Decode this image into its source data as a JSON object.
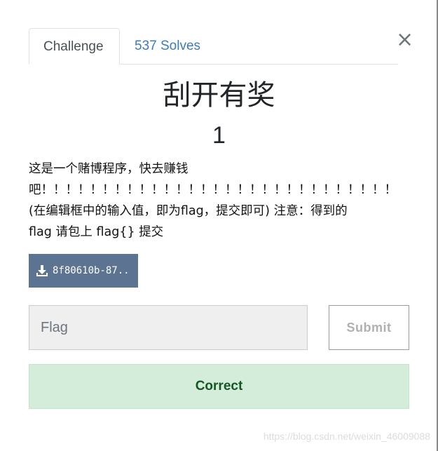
{
  "tabs": [
    {
      "label": "Challenge"
    },
    {
      "label": "537 Solves"
    }
  ],
  "close_symbol": "×",
  "challenge": {
    "title": "刮开有奖",
    "points": "1",
    "description_lines": [
      "这是一个赌博程序，快去赚钱",
      "吧！！！！！！！！！！！！！！！！！！！！！！！！！！！！！",
      "(在编辑框中的输入值，即为flag，提交即可) 注意：得到的",
      "flag 请包上 flag{} 提交"
    ],
    "file_label": "8f80610b-87..."
  },
  "form": {
    "flag_placeholder": "Flag",
    "submit_label": "Submit"
  },
  "result": {
    "message": "Correct",
    "colors": {
      "background": "#d4edda",
      "text": "#155724"
    }
  },
  "watermark": "https://blog.csdn.net/weixin_46009088",
  "icons": {
    "download": "download-icon",
    "close": "close-icon"
  }
}
